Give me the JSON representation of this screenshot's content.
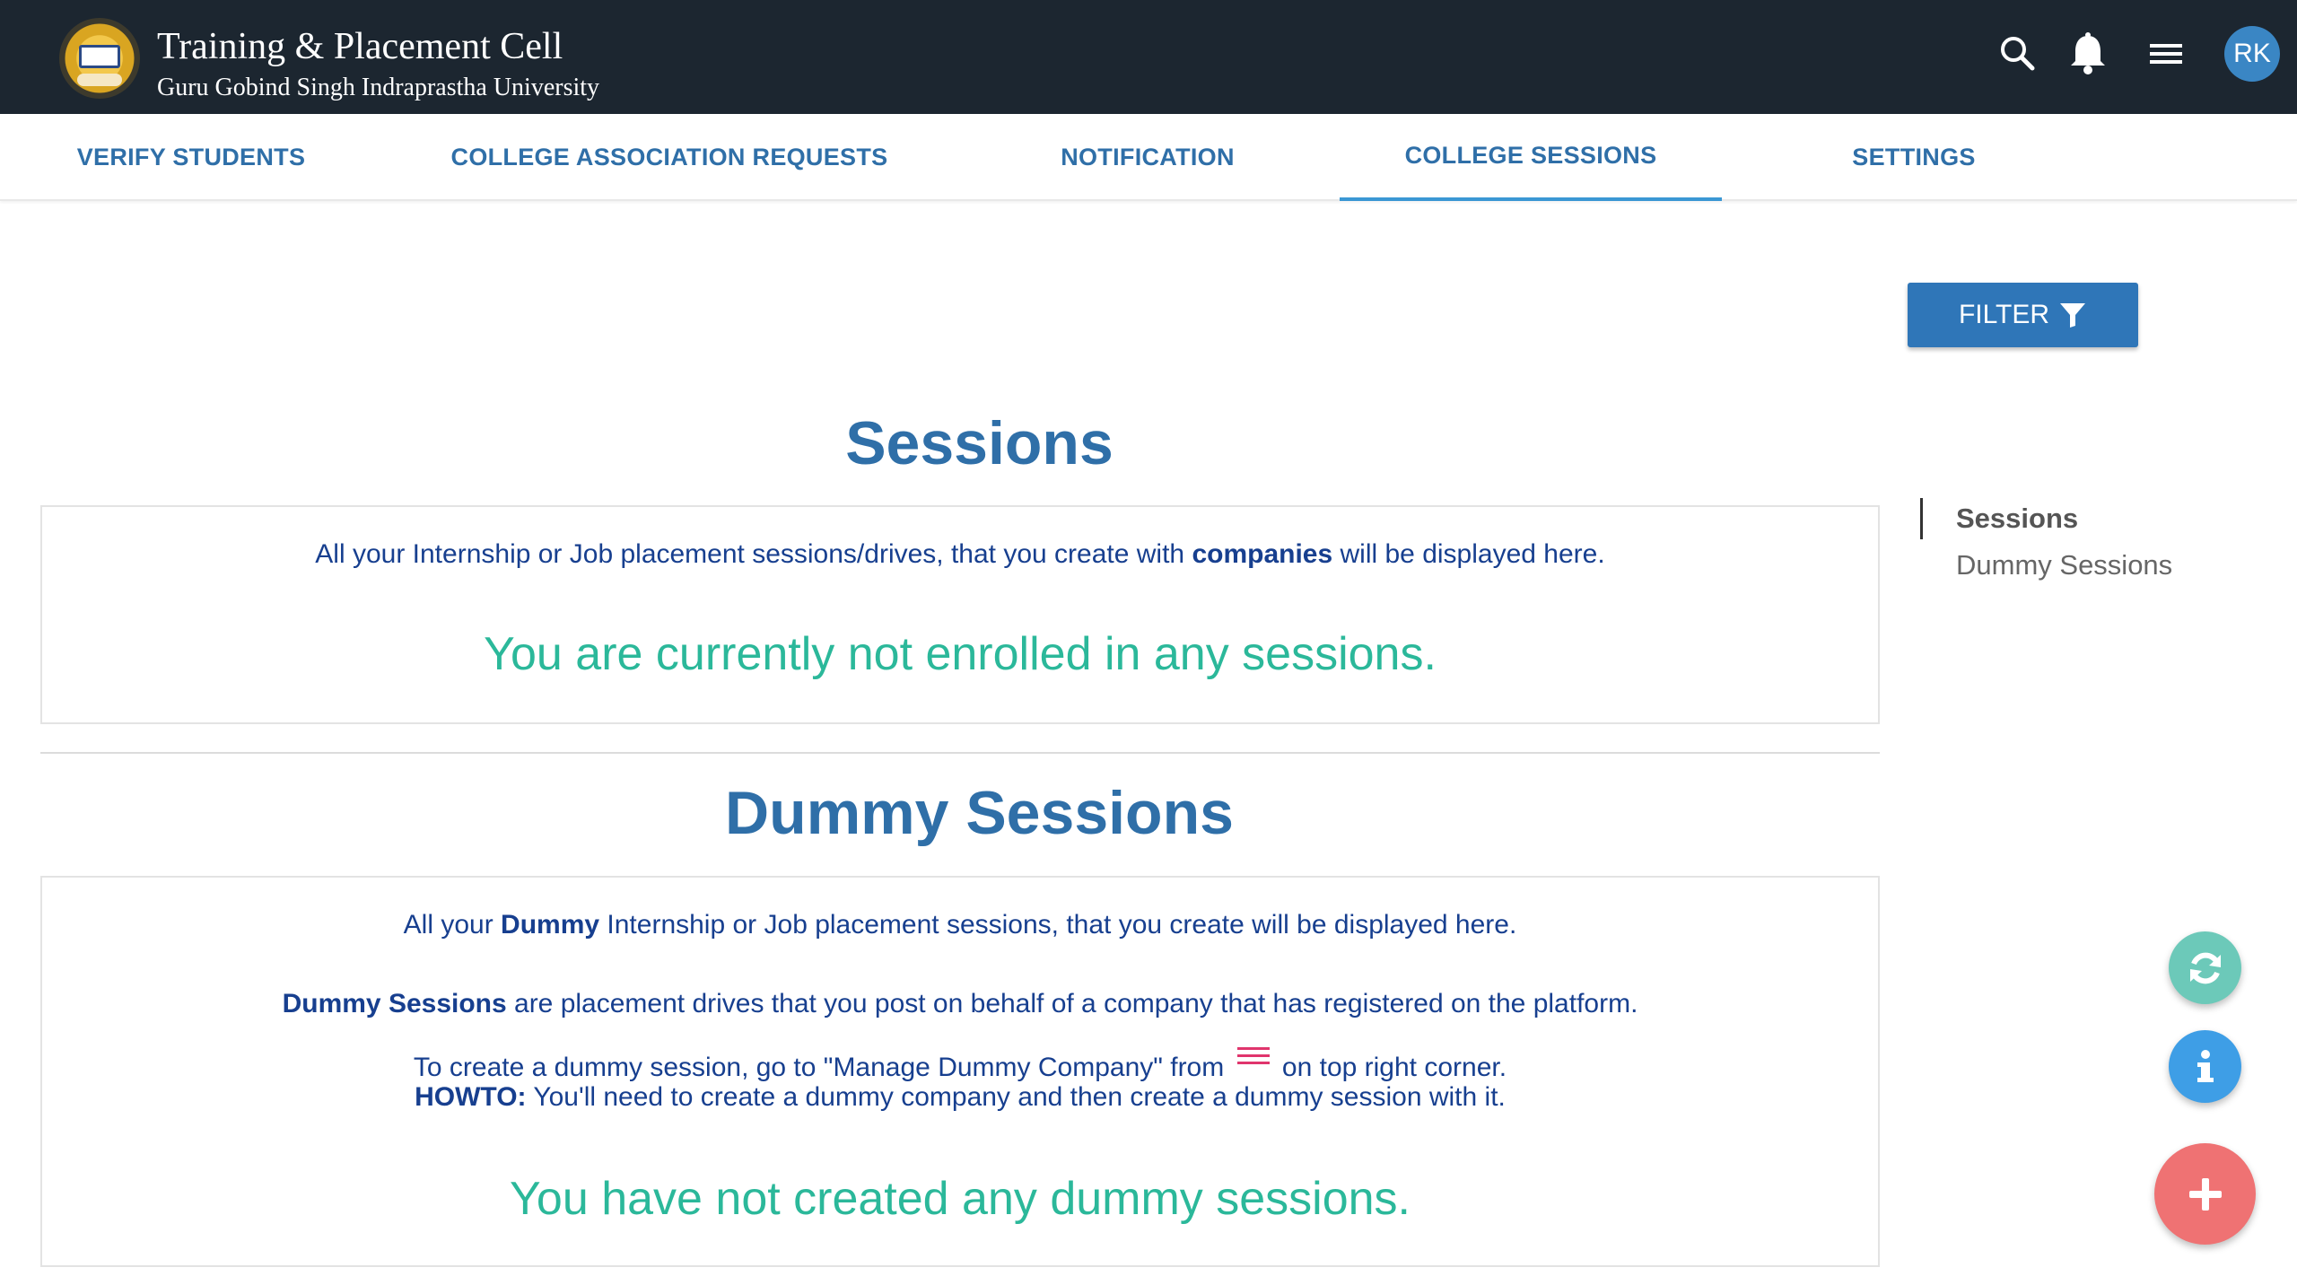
{
  "header": {
    "title": "Training & Placement Cell",
    "subtitle": "Guru Gobind Singh Indraprastha University",
    "icons": [
      "search-icon",
      "bell-icon",
      "menu-icon"
    ],
    "avatar_initials": "RK"
  },
  "tabs": [
    {
      "label": "VERIFY STUDENTS",
      "active": false
    },
    {
      "label": "COLLEGE ASSOCIATION REQUESTS",
      "active": false
    },
    {
      "label": "NOTIFICATION",
      "active": false
    },
    {
      "label": "COLLEGE SESSIONS",
      "active": true
    },
    {
      "label": "SETTINGS",
      "active": false
    }
  ],
  "filter": {
    "label": "FILTER",
    "icon": "filter-icon"
  },
  "sessions": {
    "title": "Sessions",
    "desc_pre": "All your Internship or Job placement sessions/drives, that you create with ",
    "desc_bold": "companies",
    "desc_post": " will be displayed here.",
    "empty_message": "You are currently not enrolled in any sessions."
  },
  "dummy_sessions": {
    "title": "Dummy Sessions",
    "line1_pre": "All your ",
    "line1_bold": "Dummy",
    "line1_post": " Internship or Job placement sessions, that you create will be displayed here.",
    "line2_bold": "Dummy Sessions",
    "line2_post": " are placement drives that you post on behalf of a company that has registered on the platform.",
    "line3_pre": "To create a dummy session, go to \"Manage Dummy Company\" from ",
    "line3_post": " on top right corner.",
    "line4_bold": "HOWTO:",
    "line4_post": " You'll need to create a dummy company and then create a dummy session with it.",
    "empty_message": "You have not created any dummy sessions."
  },
  "side_nav": {
    "items": [
      "Sessions",
      "Dummy Sessions"
    ]
  },
  "fabs": [
    "refresh-icon",
    "info-icon",
    "add-icon"
  ],
  "colors": {
    "header_bg": "#1c2630",
    "accent": "#2f6fa8",
    "empty_text": "#2bb89a",
    "body_text": "#173f8f",
    "add_fab": "#ef7273"
  }
}
